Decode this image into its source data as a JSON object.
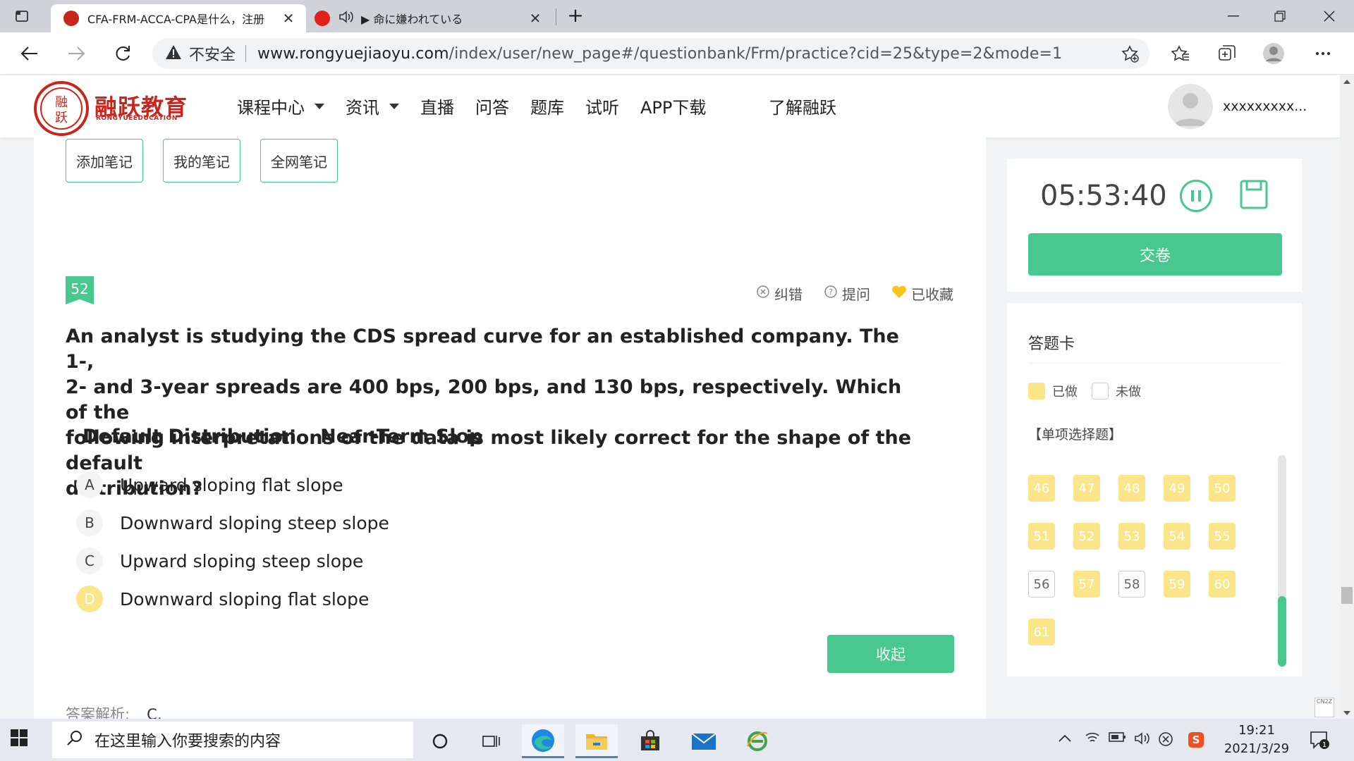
{
  "browser": {
    "tabs": [
      {
        "title": "CFA-FRM-ACCA-CPA是什么，注册",
        "active": true
      },
      {
        "title": "▶ 命に嫌われている",
        "active": false
      }
    ],
    "security_label": "不安全",
    "url_host": "www.rongyuejiaoyu.com",
    "url_path": "/index/user/new_page#/questionbank/Frm/practice?cid=25&type=2&mode=1"
  },
  "site": {
    "logo_text": "融跃教育",
    "logo_sub": "RONGYUEEDUCATION",
    "logo_seal": "融跃",
    "nav": [
      "课程中心",
      "资讯",
      "直播",
      "问答",
      "题库",
      "试听",
      "APP下载"
    ],
    "nav_dropdown": [
      true,
      true,
      false,
      false,
      false,
      false,
      false
    ],
    "about": "了解融跃",
    "username": "xxxxxxxxx..."
  },
  "notes": {
    "add": "添加笔记",
    "mine": "我的笔记",
    "all": "全网笔记"
  },
  "question": {
    "number": "52",
    "tools": {
      "correct": "纠错",
      "ask": "提问",
      "favorited": "已收藏"
    },
    "text": "An analyst is studying the CDS spread curve for an established company. The 1-, 2- and 3-year spreads are 400 bps, 200 bps, and 130 bps, respectively. Which of the following interpretations of the data is most likely correct for the shape of the default distribution?",
    "text_lines": [
      "An analyst is studying the CDS spread curve for an established company. The 1-,",
      "2- and 3-year spreads are 400 bps, 200 bps, and 130 bps, respectively. Which of the",
      "following interpretations of the data is most likely correct for the shape of the default",
      "distribution?"
    ],
    "col1": "Default Distribution",
    "col2": "Near-Term Slop",
    "options": [
      {
        "letter": "A",
        "text": "Upward sloping flat slope",
        "selected": false
      },
      {
        "letter": "B",
        "text": "Downward sloping steep slope",
        "selected": false
      },
      {
        "letter": "C",
        "text": "Upward sloping steep slope",
        "selected": false
      },
      {
        "letter": "D",
        "text": "Downward sloping flat slope",
        "selected": true
      }
    ],
    "collapse_label": "收起",
    "answer_label": "答案解析:",
    "answer_value": "C,"
  },
  "timer": {
    "time": "05:53:40",
    "submit_label": "交卷"
  },
  "answer_card": {
    "title": "答题卡",
    "legend_done": "已做",
    "legend_todo": "未做",
    "section": "【单项选择题】",
    "items": [
      {
        "n": "46",
        "done": true
      },
      {
        "n": "47",
        "done": true
      },
      {
        "n": "48",
        "done": true
      },
      {
        "n": "49",
        "done": true
      },
      {
        "n": "50",
        "done": true
      },
      {
        "n": "51",
        "done": true
      },
      {
        "n": "52",
        "done": true
      },
      {
        "n": "53",
        "done": true
      },
      {
        "n": "54",
        "done": true
      },
      {
        "n": "55",
        "done": true
      },
      {
        "n": "56",
        "done": false
      },
      {
        "n": "57",
        "done": true
      },
      {
        "n": "58",
        "done": false
      },
      {
        "n": "59",
        "done": true
      },
      {
        "n": "60",
        "done": true
      },
      {
        "n": "61",
        "done": true
      }
    ]
  },
  "taskbar": {
    "search_placeholder": "在这里输入你要搜索的内容",
    "time": "19:21",
    "date": "2021/3/29",
    "notif_count": "1",
    "badge_text": "CN2Z"
  },
  "colors": {
    "accent": "#48c78e",
    "done": "#fde68a",
    "brand": "#c8261d"
  }
}
